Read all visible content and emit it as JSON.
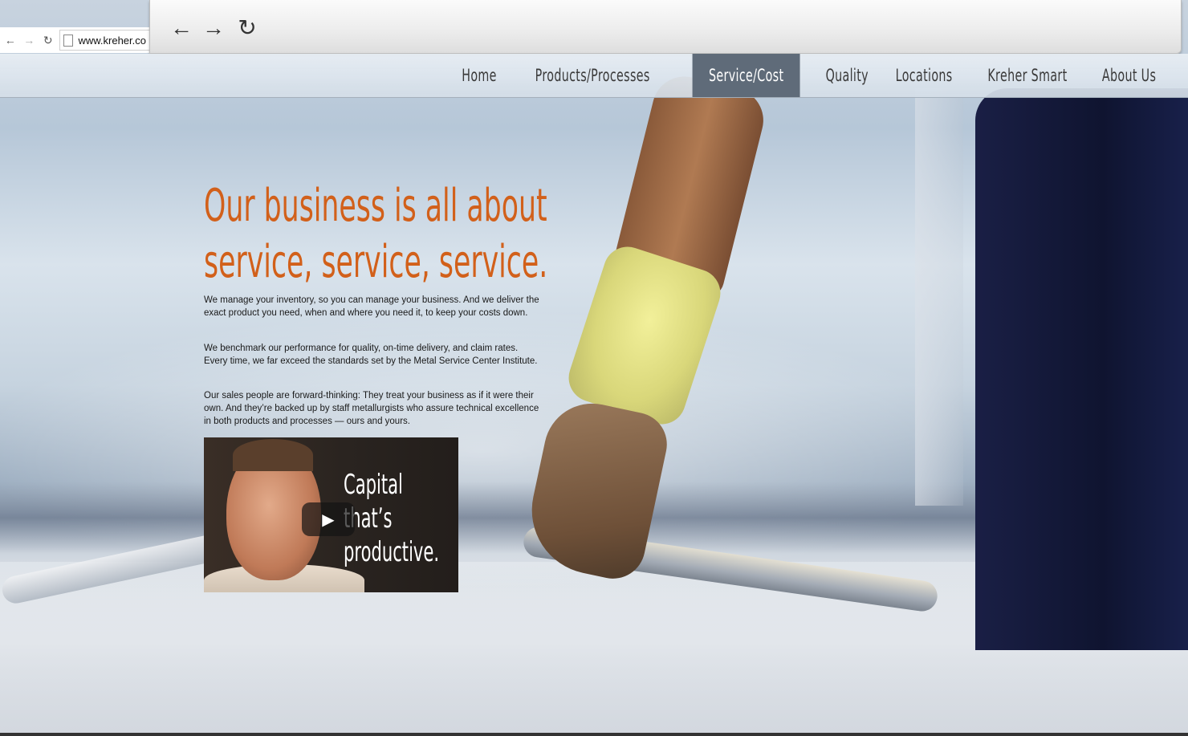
{
  "browser": {
    "address": "www.kreher.co",
    "back_glyph": "←",
    "forward_glyph": "→",
    "reload_glyph": "↻",
    "mini_back_glyph": "←",
    "mini_forward_glyph": "→",
    "mini_reload_glyph": "↻"
  },
  "nav": {
    "items": [
      {
        "label": "Home"
      },
      {
        "label": "Products/Processes"
      },
      {
        "label": "Service/Cost",
        "active": true
      },
      {
        "label": "Quality"
      },
      {
        "label": "Locations"
      },
      {
        "label": "Kreher Smart"
      },
      {
        "label": "About Us"
      }
    ]
  },
  "content": {
    "headline_line1": "Our business is all about",
    "headline_line2": "service, service, service.",
    "paragraphs": [
      "We manage your inventory, so you can manage your business. And we deliver the exact product you need, when and where you need it, to keep your costs down.",
      "We benchmark our performance for quality, on-time delivery, and claim rates. Every time, we far exceed the standards set by the Metal Service Center Institute.",
      "Our sales people are forward-thinking: They treat your business as if it were their own. And they’re backed up by staff metallurgists who assure technical excellence in both products and processes — ours and yours."
    ]
  },
  "video": {
    "caption": "Capital that’s\nproductive.",
    "play_glyph": "▶"
  },
  "colors": {
    "headline": "#d2601a",
    "nav_active_bg": "#5f6b79",
    "nav_text": "#3a3a3a"
  }
}
